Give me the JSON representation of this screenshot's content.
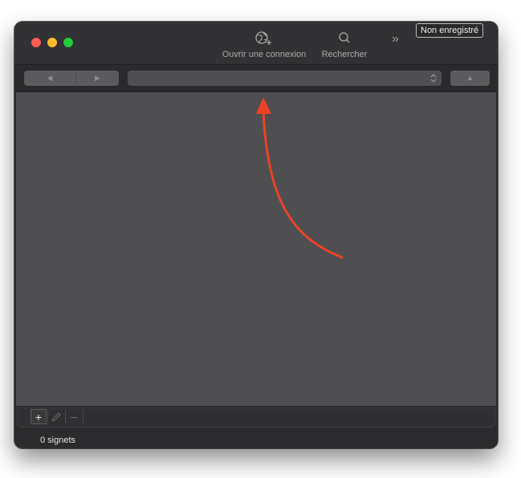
{
  "window": {
    "unregistered_badge": "Non enregistré"
  },
  "toolbar": {
    "open_connection_label": "Ouvrir une connexion",
    "open_connection_icon": "globe-plus-icon",
    "search_label": "Rechercher",
    "search_icon": "magnifier-icon",
    "overflow_glyph": "»"
  },
  "navigation": {
    "back_glyph": "◀",
    "forward_glyph": "▶",
    "upload_glyph": "▲",
    "path_selection": ""
  },
  "bottom_bar": {
    "add_glyph": "+",
    "remove_glyph": "–"
  },
  "status": {
    "bookmark_count": "0 signets"
  },
  "colors": {
    "annotation_arrow": "#ea4327",
    "close": "#fe5f57",
    "minimize": "#febc2e",
    "zoom": "#28c840"
  }
}
